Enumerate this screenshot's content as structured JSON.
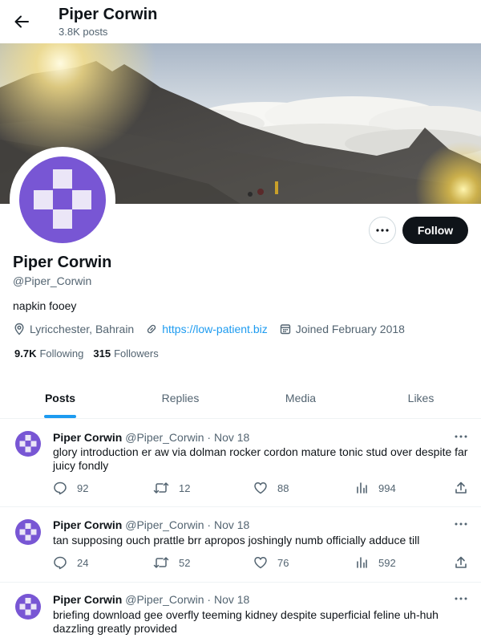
{
  "header": {
    "title": "Piper Corwin",
    "post_count": "3.8K posts"
  },
  "profile": {
    "name": "Piper Corwin",
    "handle": "@Piper_Corwin",
    "bio": "napkin fooey",
    "location": "Lyricchester, Bahrain",
    "website": "https://low-patient.biz",
    "joined": "Joined February 2018",
    "following_count": "9.7K",
    "following_label": "Following",
    "followers_count": "315",
    "followers_label": "Followers",
    "follow_button": "Follow",
    "avatar_color": "#7856d4"
  },
  "tabs": [
    {
      "label": "Posts",
      "active": true
    },
    {
      "label": "Replies",
      "active": false
    },
    {
      "label": "Media",
      "active": false
    },
    {
      "label": "Likes",
      "active": false
    }
  ],
  "posts": [
    {
      "name": "Piper Corwin",
      "handle": "@Piper_Corwin",
      "sep": "·",
      "date": "Nov 18",
      "text": "glory introduction er aw via dolman rocker cordon mature tonic stud over despite far juicy fondly",
      "replies": "92",
      "reposts": "12",
      "likes": "88",
      "views": "994"
    },
    {
      "name": "Piper Corwin",
      "handle": "@Piper_Corwin",
      "sep": "·",
      "date": "Nov 18",
      "text": "tan supposing ouch prattle brr apropos joshingly numb officially adduce till",
      "replies": "24",
      "reposts": "52",
      "likes": "76",
      "views": "592"
    },
    {
      "name": "Piper Corwin",
      "handle": "@Piper_Corwin",
      "sep": "·",
      "date": "Nov 18",
      "text": "briefing download gee overfly teeming kidney despite superficial feline uh-huh dazzling greatly provided",
      "replies": "",
      "reposts": "",
      "likes": "",
      "views": ""
    }
  ],
  "icons": {
    "back": "arrow-left-icon",
    "more": "ellipsis-icon",
    "location": "location-pin-icon",
    "link": "link-icon",
    "calendar": "calendar-icon",
    "reply": "reply-icon",
    "repost": "repost-icon",
    "like": "heart-icon",
    "views": "views-chart-icon",
    "share": "share-icon"
  },
  "colors": {
    "accent": "#1d9bf0",
    "text": "#0f1419",
    "muted": "#536471",
    "avatar": "#7856d4"
  }
}
